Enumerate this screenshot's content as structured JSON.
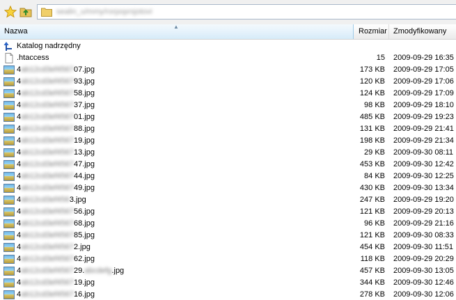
{
  "toolbar": {
    "favorites_icon": "star-icon",
    "up_icon": "folder-up-icon",
    "path": "sealin_u/mmy/rorpoprsjotovi"
  },
  "columns": {
    "name": "Nazwa",
    "size": "Rozmiar",
    "modified": "Zmodyfikowany"
  },
  "parent": {
    "label": "Katalog nadrzędny",
    "icon": "parent-dir-icon"
  },
  "files": [
    {
      "icon": "document-icon",
      "prefix": ".htaccess",
      "hidden": "",
      "suffix": "",
      "size": "15",
      "modified": "2009-09-29 16:35"
    },
    {
      "icon": "image-icon",
      "prefix": "4",
      "hidden": "ab12cd3ef4567",
      "suffix": "07.jpg",
      "size": "173 KB",
      "modified": "2009-09-29 17:05"
    },
    {
      "icon": "image-icon",
      "prefix": "4",
      "hidden": "ab12cd3ef4567",
      "suffix": "93.jpg",
      "size": "120 KB",
      "modified": "2009-09-29 17:06"
    },
    {
      "icon": "image-icon",
      "prefix": "4",
      "hidden": "ab12cd3ef4567",
      "suffix": "58.jpg",
      "size": "124 KB",
      "modified": "2009-09-29 17:09"
    },
    {
      "icon": "image-icon",
      "prefix": "4",
      "hidden": "ab12cd3ef4567",
      "suffix": "37.jpg",
      "size": "98 KB",
      "modified": "2009-09-29 18:10"
    },
    {
      "icon": "image-icon",
      "prefix": "4",
      "hidden": "ab12cd3ef4567",
      "suffix": "01.jpg",
      "size": "485 KB",
      "modified": "2009-09-29 19:23"
    },
    {
      "icon": "image-icon",
      "prefix": "4",
      "hidden": "ab12cd3ef4567",
      "suffix": "88.jpg",
      "size": "131 KB",
      "modified": "2009-09-29 21:41"
    },
    {
      "icon": "image-icon",
      "prefix": "4",
      "hidden": "ab12cd3ef4567",
      "suffix": "19.jpg",
      "size": "198 KB",
      "modified": "2009-09-29 21:34"
    },
    {
      "icon": "image-icon",
      "prefix": "4",
      "hidden": "ab12cd3ef4567",
      "suffix": "13.jpg",
      "size": "29 KB",
      "modified": "2009-09-30 08:11"
    },
    {
      "icon": "image-icon",
      "prefix": "4",
      "hidden": "ab12cd3ef4567",
      "suffix": "47.jpg",
      "size": "453 KB",
      "modified": "2009-09-30 12:42"
    },
    {
      "icon": "image-icon",
      "prefix": "4",
      "hidden": "ab12cd3ef4567",
      "suffix": "44.jpg",
      "size": "84 KB",
      "modified": "2009-09-30 12:25"
    },
    {
      "icon": "image-icon",
      "prefix": "4",
      "hidden": "ab12cd3ef4567",
      "suffix": "49.jpg",
      "size": "430 KB",
      "modified": "2009-09-30 13:34"
    },
    {
      "icon": "image-icon",
      "prefix": "4",
      "hidden": "ab12cd3ef456",
      "suffix": "3.jpg",
      "size": "247 KB",
      "modified": "2009-09-29 19:20"
    },
    {
      "icon": "image-icon",
      "prefix": "4",
      "hidden": "ab12cd3ef4567",
      "suffix": "56.jpg",
      "size": "121 KB",
      "modified": "2009-09-29 20:13"
    },
    {
      "icon": "image-icon",
      "prefix": "4",
      "hidden": "ab12cd3ef4567",
      "suffix": "68.jpg",
      "size": "96 KB",
      "modified": "2009-09-29 21:16"
    },
    {
      "icon": "image-icon",
      "prefix": "4",
      "hidden": "ab12cd3ef4567",
      "suffix": "85.jpg",
      "size": "121 KB",
      "modified": "2009-09-30 08:33"
    },
    {
      "icon": "image-icon",
      "prefix": "4",
      "hidden": "ab12cd3ef4567",
      "suffix": "2.jpg",
      "size": "454 KB",
      "modified": "2009-09-30 11:51"
    },
    {
      "icon": "image-icon",
      "prefix": "4",
      "hidden": "ab12cd3ef4567",
      "suffix": "62.jpg",
      "size": "118 KB",
      "modified": "2009-09-29 20:29"
    },
    {
      "icon": "image-icon",
      "prefix": "4",
      "hidden": "ab12cd3ef4567",
      "suffix": "29.",
      "hidden2": "abcdefg",
      "suffix2": ".jpg",
      "size": "457 KB",
      "modified": "2009-09-30 13:05"
    },
    {
      "icon": "image-icon",
      "prefix": "4",
      "hidden": "ab12cd3ef4567",
      "suffix": "19.jpg",
      "size": "344 KB",
      "modified": "2009-09-30 12:46"
    },
    {
      "icon": "image-icon",
      "prefix": "4",
      "hidden": "ab12cd3ef4567",
      "suffix": "16.jpg",
      "size": "278 KB",
      "modified": "2009-09-30 12:06"
    }
  ]
}
